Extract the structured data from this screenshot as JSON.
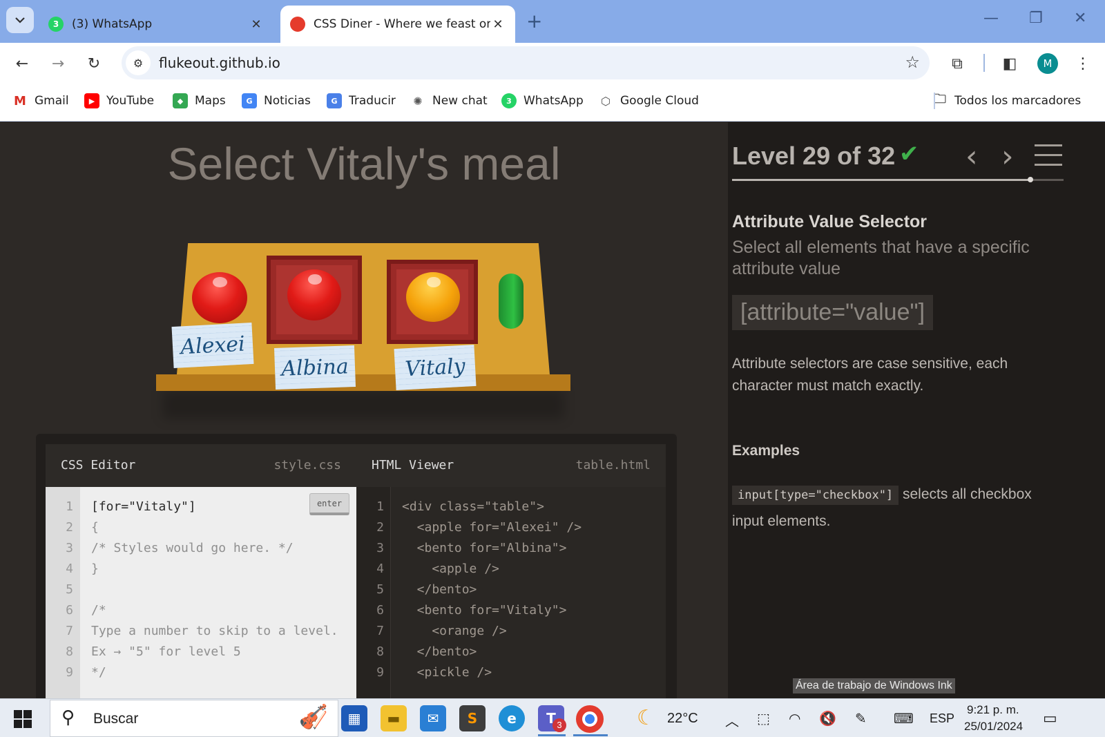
{
  "browser": {
    "tabs": [
      {
        "title": "(3) WhatsApp",
        "badge": "3",
        "active": false
      },
      {
        "title": "CSS Diner - Where we feast on CSS",
        "active": true
      }
    ],
    "url": "flukeout.github.io",
    "profile_initial": "M",
    "bookmarks": [
      "Gmail",
      "YouTube",
      "Maps",
      "Noticias",
      "Traducir",
      "New chat",
      "WhatsApp",
      "Google Cloud"
    ],
    "all_bookmarks": "Todos los marcadores"
  },
  "game": {
    "order_title": "Select Vitaly's meal",
    "notes": [
      "Alexei",
      "Albina",
      "Vitaly"
    ],
    "editor": {
      "css_title": "CSS Editor",
      "css_file": "style.css",
      "html_title": "HTML Viewer",
      "html_file": "table.html",
      "enter_label": "enter",
      "line_numbers": [
        "1",
        "2",
        "3",
        "4",
        "5",
        "6",
        "7",
        "8",
        "9"
      ],
      "css_lines": [
        "[for=\"Vitaly\"]",
        "{",
        "/* Styles would go here. */",
        "}",
        "",
        "/*",
        "Type a number to skip to a level.",
        "Ex → \"5\" for level 5",
        "*/"
      ],
      "html_lines": [
        "<div class=\"table\">",
        "  <apple for=\"Alexei\" />",
        "  <bento for=\"Albina\">",
        "    <apple />",
        "  </bento>",
        "  <bento for=\"Vitaly\">",
        "    <orange />",
        "  </bento>",
        "  <pickle />"
      ]
    }
  },
  "sidebar": {
    "level_text": "Level 29 of 32",
    "check_icon": "✔",
    "progress_fraction": 0.9,
    "selector_name": "Attribute Value Selector",
    "selector_title": "Select all elements that have a specific attribute value",
    "syntax": "[attribute=\"value\"]",
    "hint": "Attribute selectors are case sensitive, each character must match exactly.",
    "examples_title": "Examples",
    "example_code": "input[type=\"checkbox\"]",
    "example_text": " selects all checkbox input elements."
  },
  "tooltip": "Área de trabajo de Windows Ink",
  "taskbar": {
    "search_placeholder": "Buscar",
    "teams_badge": "3",
    "weather": "22°C",
    "language": "ESP",
    "time": "9:21 p. m.",
    "date": "25/01/2024"
  }
}
